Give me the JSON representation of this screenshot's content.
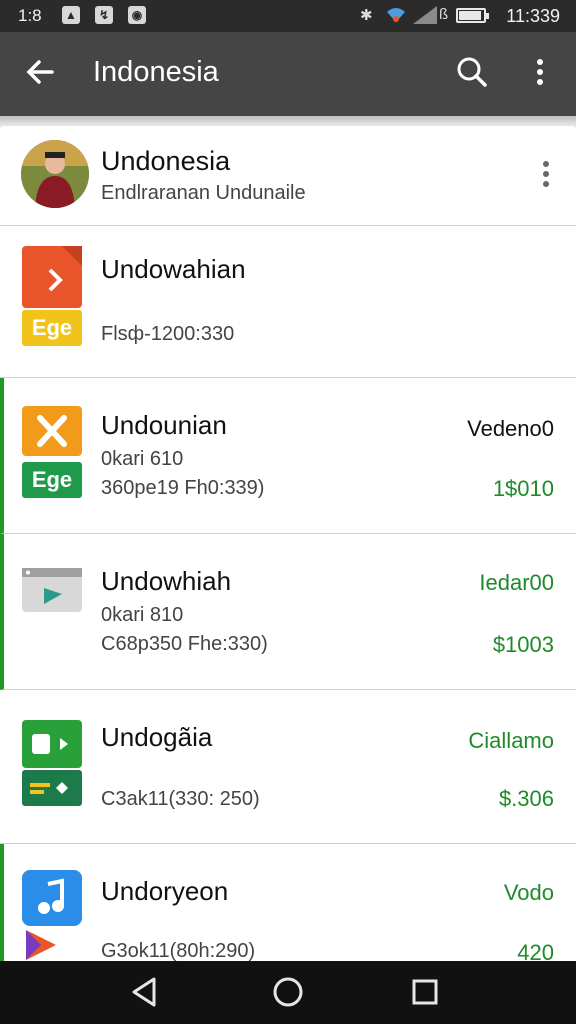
{
  "status_bar": {
    "time_left": "1:8",
    "clock": "11:339",
    "icons": [
      "photo-icon",
      "note-icon",
      "app-icon",
      "bluetooth-icon",
      "wifi-icon",
      "signal-icon",
      "battery-icon"
    ],
    "battery_level": 0.9
  },
  "app_bar": {
    "title": "Indonesia",
    "icons": [
      "back-arrow-icon",
      "search-icon",
      "more-vert-icon"
    ]
  },
  "profile": {
    "name": "Undonesia",
    "subtitle": "Endlraranan Undunaile"
  },
  "items": [
    {
      "title": "Undowahian",
      "label": "Ege",
      "line1": "",
      "line2": "Flsф-1200:330",
      "right_top": "",
      "right_bottom": "",
      "icon": "slides-icon",
      "colors": {
        "top": "#e8552a",
        "bottom": "#f2c31a"
      }
    },
    {
      "title": "Undounian",
      "label": "Ege",
      "line1": "0kari 610",
      "line2": "360pe19 Fh0:339)",
      "right_top": "Vedeno0",
      "right_bottom": "1$010",
      "icon": "tools-icon",
      "colors": {
        "top": "#f29a1a",
        "bottom": "#1f9a4a"
      }
    },
    {
      "title": "Undowhiah",
      "label": "",
      "line1": "0kari 810",
      "line2": "C68p350 Fhe:330)",
      "right_top": "Iedar00",
      "right_bottom": "$1003",
      "icon": "browser-icon",
      "colors": {
        "top": "#d8d8d8",
        "bottom": ""
      }
    },
    {
      "title": "Undogãia",
      "label": "",
      "line1": "",
      "line2": "C3ak11(330: 250)",
      "right_top": "Ciallamo",
      "right_bottom": "$.306",
      "icon": "game-icon",
      "colors": {
        "top": "#2aa03a",
        "bottom": "#1d7a4a"
      }
    },
    {
      "title": "Undoryeon",
      "label": "",
      "line1": "",
      "line2": "G3ok11(80h:290)",
      "right_top": "Vodo",
      "right_bottom": "420",
      "icon": "music-icon",
      "colors": {
        "top": "#2a8ee8",
        "bottom": ""
      }
    }
  ],
  "nav_bar": {
    "icons": [
      "back-triangle-icon",
      "home-circle-icon",
      "recents-square-icon"
    ]
  },
  "colors": {
    "accent": "#1f9a2a",
    "app_bar": "#454545",
    "status_bar": "#2b2b2b"
  }
}
